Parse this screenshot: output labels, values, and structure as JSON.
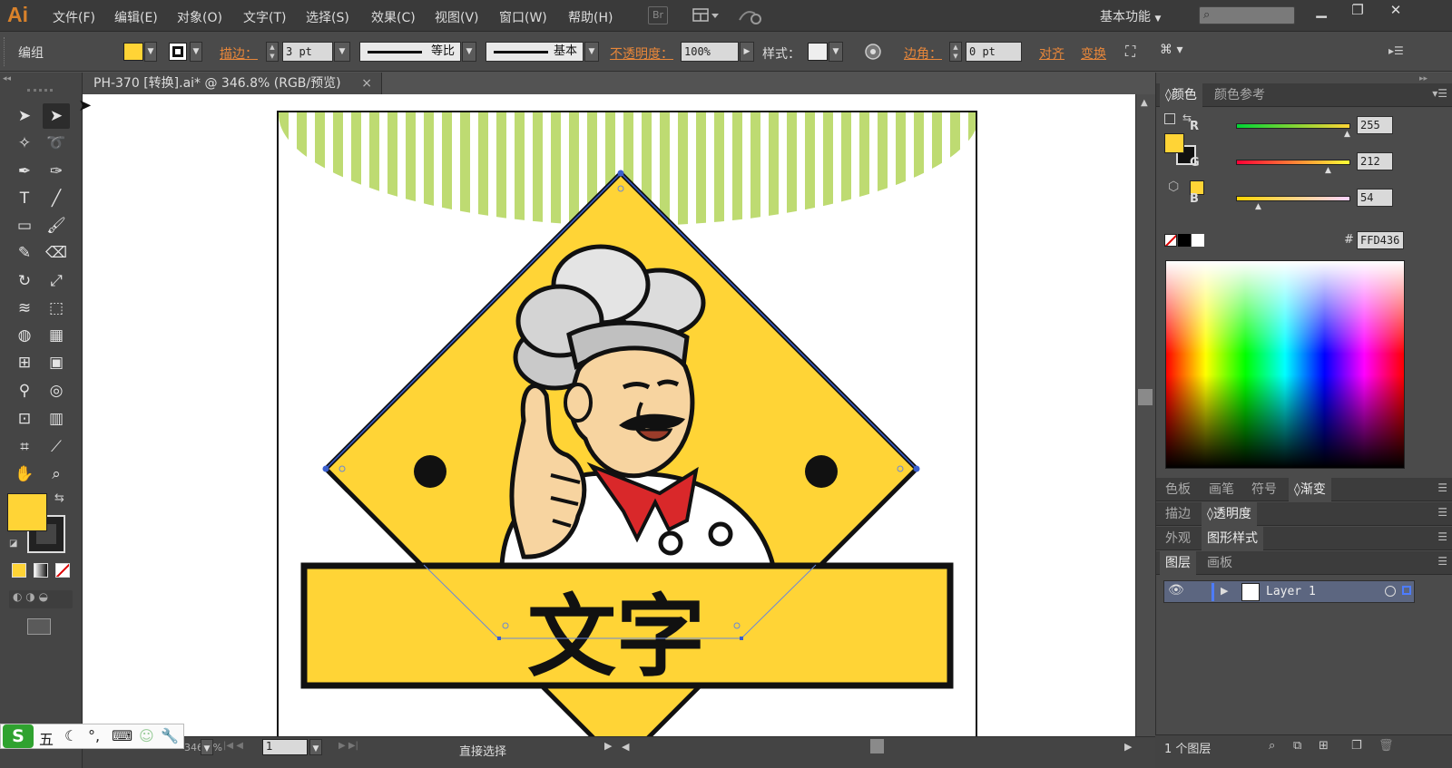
{
  "app": {
    "logo": "Ai",
    "workspace": "基本功能",
    "search_placeholder": "",
    "bridge_label": "Br"
  },
  "menu": [
    "文件(F)",
    "编辑(E)",
    "对象(O)",
    "文字(T)",
    "选择(S)",
    "效果(C)",
    "视图(V)",
    "窗口(W)",
    "帮助(H)"
  ],
  "control": {
    "selection_label": "编组",
    "fill_color": "#FFD436",
    "stroke_label": "描边：",
    "stroke_weight": "3 pt",
    "profile_label": "等比",
    "brush_label": "基本",
    "opacity_label": "不透明度：",
    "opacity_value": "100%",
    "style_label": "样式：",
    "corner_label": "边角：",
    "corner_value": "0 pt",
    "align_label": "对齐",
    "transform_label": "变换"
  },
  "document": {
    "tab_title": "PH-370 [转换].ai* @ 346.8% (RGB/预览)",
    "close_glyph": "×",
    "artwork_caption": "文字"
  },
  "status": {
    "tool": "直接选择",
    "zoom": "346.8%",
    "page": "1"
  },
  "ime": {
    "label": "五"
  },
  "color_panel": {
    "tab_active": "颜色",
    "tab_other": "颜色参考",
    "r_label": "R",
    "r_value": "255",
    "g_label": "G",
    "g_value": "212",
    "b_label": "B",
    "b_value": "54",
    "hex_label": "#",
    "hex_value": "FFD436",
    "r_level": 1.0,
    "g_level": 0.831,
    "b_level": 0.212
  },
  "panels": {
    "row1": [
      "色板",
      "画笔",
      "符号",
      "渐变"
    ],
    "row2": [
      "描边",
      "透明度"
    ],
    "row3": [
      "外观",
      "图形样式"
    ],
    "row4": [
      "图层",
      "画板"
    ]
  },
  "layers": {
    "layer_name": "Layer 1",
    "footer": "1 个图层"
  },
  "colors": {
    "accent_yellow": "#FFD436",
    "stripe_green": "#BEDB72",
    "stroke_black": "#111111",
    "orange_link": "#E8873A",
    "layer_highlight": "#5C6680"
  }
}
